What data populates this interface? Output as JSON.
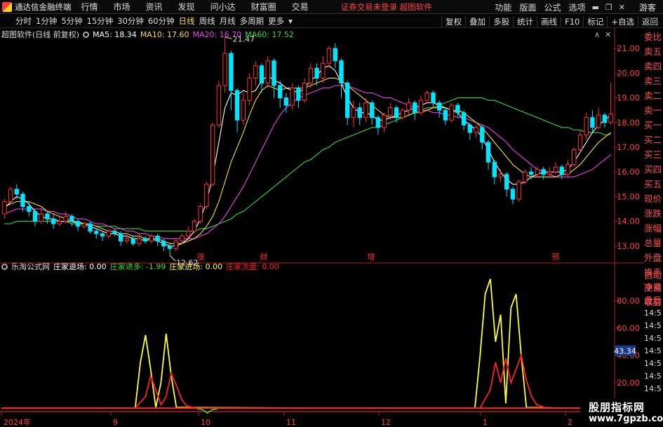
{
  "app": {
    "name": "通达信金融终端"
  },
  "menu": [
    "行情",
    "市场",
    "资讯",
    "发现",
    "问小达",
    "财富圈",
    "交易"
  ],
  "center_notice": "证券交易未登录  超图软件",
  "right_menu": [
    "功能",
    "版面",
    "公式",
    "选项"
  ],
  "guest": "游客",
  "periods": [
    "分时",
    "1分钟",
    "5分钟",
    "15分钟",
    "30分钟",
    "60分钟",
    "日线",
    "周线",
    "月线",
    "多周期",
    "更多"
  ],
  "active_period": "日线",
  "toolbar_right": [
    "复权",
    "叠加",
    "多股",
    "统计",
    "画线",
    "F10",
    "标记",
    "+自选",
    "返回"
  ],
  "main_info": {
    "title": "超图软件(日线 前复权)",
    "ma5": "MA5: 18.34",
    "ma10": "MA10: 17.60",
    "ma20": "MA20: 16.70",
    "ma60": "MA60: 17.52"
  },
  "sub_info": {
    "title": "乐淘公式网",
    "l1": "庄家退场: 0.00",
    "l2": "庄家诱多: -1.99",
    "l3": "庄家进场: 0.00",
    "l4": "庄家洗盘: 0.00"
  },
  "colors": {
    "up": "#ff3232",
    "down": "#00e5ff",
    "ma5": "#ffffff",
    "ma10": "#ffdd33",
    "ma20": "#ee44ee",
    "ma60": "#33dd33",
    "axis": "#b02020",
    "yellow": "#ffff33",
    "red": "#ff2020"
  },
  "side_panel": {
    "main": [
      {
        "t": "委比",
        "c": "r"
      },
      {
        "t": "卖五",
        "c": "r"
      },
      {
        "t": "卖四",
        "c": "r"
      },
      {
        "t": "卖三",
        "c": "r"
      },
      {
        "t": "卖二",
        "c": "r"
      },
      {
        "t": "卖一",
        "c": "r"
      },
      {
        "t": "买一",
        "c": "r"
      },
      {
        "t": "买二",
        "c": "r"
      },
      {
        "t": "买三",
        "c": "r"
      },
      {
        "t": "买四",
        "c": "r"
      },
      {
        "t": "买五",
        "c": "r"
      },
      {
        "t": "现价",
        "c": "r"
      },
      {
        "t": "涨跌",
        "c": "r"
      },
      {
        "t": "涨幅",
        "c": "r"
      },
      {
        "t": "总量",
        "c": "r"
      },
      {
        "t": "外盘",
        "c": "r"
      },
      {
        "t": "换手",
        "c": "r"
      },
      {
        "t": "净资",
        "c": "r"
      },
      {
        "t": "收益",
        "c": "r"
      }
    ],
    "sub": [
      {
        "t": "自动",
        "c": "r"
      },
      {
        "t": "交易",
        "c": "r"
      },
      {
        "t": "盘后",
        "c": "r"
      },
      {
        "t": "14:5",
        "c": "time"
      },
      {
        "t": "14:5",
        "c": "time"
      },
      {
        "t": "14:5",
        "c": "time"
      },
      {
        "t": "14:5",
        "c": "time"
      },
      {
        "t": "14:5",
        "c": "time"
      },
      {
        "t": "14:5",
        "c": "time"
      },
      {
        "t": "14:5",
        "c": "time"
      },
      {
        "t": "14:5",
        "c": "time"
      },
      {
        "t": "14:5",
        "c": "time"
      }
    ]
  },
  "watermark": {
    "line1": "股朋指标网",
    "line2": "www.7gpzb.com"
  },
  "chart_data": {
    "type": "candlestick",
    "price_ticks": [
      "21.00",
      "20.00",
      "19.00",
      "18.00",
      "17.00",
      "16.00",
      "15.00",
      "14.00",
      "13.00"
    ],
    "price_range": [
      12.4,
      21.6
    ],
    "high_label": "21.47",
    "low_label": "12.62",
    "event_markers": [
      "涨",
      "财",
      "增",
      "预"
    ],
    "sub_ticks": [
      "80.00",
      "60.00",
      "40.00",
      "20.00"
    ],
    "sub_range": [
      0,
      100
    ],
    "sub_current": "43.34",
    "x_labels": [
      "2024年",
      "9",
      "10",
      "11",
      "12",
      "1",
      "2"
    ],
    "candles": [
      [
        14.3,
        14.8,
        14.1,
        14.9
      ],
      [
        14.8,
        15.3,
        14.7,
        15.4
      ],
      [
        15.3,
        15.1,
        14.9,
        15.5
      ],
      [
        15.1,
        14.6,
        14.4,
        15.2
      ],
      [
        14.6,
        14.4,
        14.2,
        14.8
      ],
      [
        14.4,
        14.0,
        13.8,
        14.5
      ],
      [
        14.0,
        14.3,
        13.9,
        14.5
      ],
      [
        14.3,
        14.1,
        13.9,
        14.4
      ],
      [
        14.1,
        13.9,
        13.7,
        14.3
      ],
      [
        13.9,
        14.0,
        13.8,
        14.2
      ],
      [
        14.0,
        14.2,
        13.9,
        14.4
      ],
      [
        14.2,
        14.0,
        13.8,
        14.3
      ],
      [
        14.0,
        13.8,
        13.6,
        14.1
      ],
      [
        13.8,
        13.9,
        13.7,
        14.0
      ],
      [
        13.9,
        13.6,
        13.5,
        14.0
      ],
      [
        13.6,
        13.5,
        13.3,
        13.7
      ],
      [
        13.5,
        13.4,
        13.2,
        13.6
      ],
      [
        13.4,
        13.6,
        13.3,
        13.7
      ],
      [
        13.6,
        13.5,
        13.4,
        13.7
      ],
      [
        13.5,
        13.2,
        13.0,
        13.6
      ],
      [
        13.2,
        13.3,
        13.1,
        13.5
      ],
      [
        13.3,
        13.1,
        13.0,
        13.4
      ],
      [
        13.1,
        13.3,
        13.0,
        13.5
      ],
      [
        13.3,
        13.2,
        13.1,
        13.4
      ],
      [
        13.2,
        13.4,
        13.1,
        13.5
      ],
      [
        13.4,
        13.2,
        13.0,
        13.5
      ],
      [
        13.2,
        13.0,
        12.8,
        13.3
      ],
      [
        13.0,
        12.9,
        12.62,
        13.1
      ],
      [
        12.9,
        13.2,
        12.8,
        13.3
      ],
      [
        13.2,
        13.4,
        13.1,
        13.5
      ],
      [
        13.4,
        13.6,
        13.3,
        13.8
      ],
      [
        13.6,
        14.0,
        13.5,
        14.1
      ],
      [
        14.0,
        14.6,
        13.9,
        14.7
      ],
      [
        14.6,
        15.5,
        14.5,
        15.6
      ],
      [
        15.5,
        17.9,
        15.4,
        18.0
      ],
      [
        17.9,
        19.5,
        17.8,
        19.7
      ],
      [
        19.5,
        20.8,
        19.2,
        21.47
      ],
      [
        20.8,
        19.3,
        18.5,
        20.9
      ],
      [
        19.3,
        18.1,
        17.6,
        19.4
      ],
      [
        18.1,
        18.9,
        17.9,
        19.2
      ],
      [
        18.9,
        19.8,
        18.7,
        20.0
      ],
      [
        19.8,
        20.3,
        19.5,
        20.5
      ],
      [
        20.3,
        19.6,
        19.2,
        20.4
      ],
      [
        19.6,
        20.5,
        19.4,
        20.7
      ],
      [
        20.5,
        19.5,
        19.0,
        20.6
      ],
      [
        19.5,
        19.0,
        18.6,
        19.7
      ],
      [
        19.0,
        18.7,
        18.4,
        19.2
      ],
      [
        18.7,
        19.4,
        18.5,
        19.6
      ],
      [
        19.4,
        18.9,
        18.6,
        19.5
      ],
      [
        18.9,
        19.6,
        18.8,
        19.8
      ],
      [
        19.6,
        20.2,
        19.4,
        20.4
      ],
      [
        20.2,
        19.8,
        19.5,
        20.4
      ],
      [
        19.8,
        20.4,
        19.6,
        20.7
      ],
      [
        20.4,
        21.0,
        20.2,
        21.1
      ],
      [
        21.0,
        20.5,
        20.2,
        21.2
      ],
      [
        20.5,
        19.6,
        19.0,
        20.6
      ],
      [
        19.6,
        18.2,
        17.9,
        19.7
      ],
      [
        18.2,
        18.6,
        17.8,
        18.9
      ],
      [
        18.6,
        18.2,
        17.9,
        18.8
      ],
      [
        18.2,
        18.8,
        18.0,
        19.0
      ],
      [
        18.8,
        18.2,
        17.9,
        18.9
      ],
      [
        18.2,
        17.8,
        17.5,
        18.3
      ],
      [
        17.8,
        18.3,
        17.6,
        18.4
      ],
      [
        18.3,
        18.6,
        18.1,
        18.8
      ],
      [
        18.6,
        18.2,
        18.0,
        18.7
      ],
      [
        18.2,
        18.5,
        18.1,
        18.6
      ],
      [
        18.5,
        18.8,
        18.3,
        19.0
      ],
      [
        18.8,
        18.4,
        18.1,
        18.9
      ],
      [
        18.4,
        18.9,
        18.3,
        19.1
      ],
      [
        18.9,
        19.2,
        18.8,
        19.3
      ],
      [
        19.2,
        18.8,
        18.6,
        19.3
      ],
      [
        18.8,
        18.5,
        18.2,
        18.9
      ],
      [
        18.5,
        18.1,
        17.9,
        18.6
      ],
      [
        18.1,
        18.7,
        18.0,
        18.8
      ],
      [
        18.7,
        18.4,
        18.2,
        18.8
      ],
      [
        18.4,
        17.9,
        17.7,
        18.5
      ],
      [
        17.9,
        17.6,
        17.3,
        18.0
      ],
      [
        17.6,
        17.8,
        17.4,
        17.9
      ],
      [
        17.8,
        17.2,
        16.9,
        17.9
      ],
      [
        17.2,
        16.4,
        16.1,
        17.3
      ],
      [
        16.4,
        15.8,
        15.5,
        16.5
      ],
      [
        15.8,
        15.9,
        15.6,
        16.1
      ],
      [
        15.9,
        15.3,
        15.0,
        16.0
      ],
      [
        15.3,
        14.9,
        14.7,
        15.4
      ],
      [
        14.9,
        15.6,
        14.8,
        15.7
      ],
      [
        15.6,
        16.0,
        15.5,
        16.1
      ],
      [
        16.0,
        15.9,
        15.7,
        16.2
      ],
      [
        15.9,
        16.1,
        15.8,
        16.2
      ],
      [
        16.1,
        15.9,
        15.7,
        16.2
      ],
      [
        15.9,
        16.0,
        15.8,
        16.2
      ],
      [
        16.0,
        16.2,
        15.9,
        16.4
      ],
      [
        16.2,
        15.9,
        15.7,
        16.3
      ],
      [
        15.9,
        16.3,
        15.8,
        16.5
      ],
      [
        16.3,
        16.9,
        16.2,
        17.0
      ],
      [
        16.9,
        17.5,
        16.8,
        17.7
      ],
      [
        17.5,
        18.2,
        17.3,
        18.4
      ],
      [
        18.2,
        17.8,
        17.6,
        18.5
      ],
      [
        17.8,
        18.3,
        17.7,
        18.6
      ],
      [
        18.3,
        18.0,
        17.8,
        18.4
      ],
      [
        18.0,
        18.34,
        17.9,
        19.6
      ]
    ],
    "ma5": [
      14.5,
      14.8,
      15.0,
      14.9,
      14.7,
      14.4,
      14.2,
      14.1,
      14.1,
      14.0,
      14.0,
      14.0,
      13.9,
      13.9,
      13.8,
      13.7,
      13.6,
      13.5,
      13.5,
      13.4,
      13.4,
      13.3,
      13.3,
      13.2,
      13.3,
      13.2,
      13.1,
      13.0,
      13.0,
      13.1,
      13.3,
      13.6,
      14.1,
      14.8,
      15.8,
      17.2,
      18.6,
      19.2,
      19.1,
      19.3,
      19.2,
      19.3,
      19.7,
      19.9,
      19.7,
      19.6,
      19.4,
      19.3,
      19.2,
      19.4,
      19.7,
      19.9,
      20.2,
      20.3,
      20.1,
      19.6,
      19.0,
      18.6,
      18.4,
      18.4,
      18.3,
      18.1,
      18.1,
      18.2,
      18.3,
      18.4,
      18.5,
      18.6,
      18.7,
      18.8,
      18.8,
      18.7,
      18.6,
      18.5,
      18.4,
      18.1,
      17.9,
      17.7,
      17.4,
      16.9,
      16.4,
      16.0,
      15.7,
      15.5,
      15.5,
      15.6,
      15.8,
      15.9,
      16.0,
      16.0,
      16.0,
      16.0,
      16.1,
      16.4,
      16.8,
      17.2,
      17.6,
      17.9,
      18.1,
      18.3
    ],
    "ma10": [
      14.6,
      14.7,
      14.8,
      14.8,
      14.8,
      14.7,
      14.6,
      14.4,
      14.3,
      14.2,
      14.1,
      14.0,
      14.0,
      13.9,
      13.9,
      13.8,
      13.7,
      13.6,
      13.6,
      13.5,
      13.5,
      13.4,
      13.4,
      13.3,
      13.3,
      13.3,
      13.2,
      13.1,
      13.1,
      13.1,
      13.2,
      13.3,
      13.5,
      13.8,
      14.2,
      14.8,
      15.6,
      16.4,
      17.0,
      17.6,
      18.3,
      18.9,
      19.3,
      19.5,
      19.4,
      19.3,
      19.4,
      19.4,
      19.4,
      19.4,
      19.5,
      19.6,
      19.7,
      19.8,
      19.8,
      19.7,
      19.5,
      19.3,
      19.1,
      18.9,
      18.7,
      18.5,
      18.3,
      18.2,
      18.2,
      18.2,
      18.3,
      18.4,
      18.4,
      18.5,
      18.6,
      18.6,
      18.6,
      18.5,
      18.5,
      18.4,
      18.2,
      18.0,
      17.8,
      17.5,
      17.2,
      16.9,
      16.6,
      16.3,
      16.1,
      15.9,
      15.8,
      15.8,
      15.8,
      15.8,
      15.8,
      15.9,
      15.9,
      16.1,
      16.3,
      16.6,
      16.9,
      17.2,
      17.4,
      17.6
    ],
    "ma20": [
      14.3,
      14.4,
      14.5,
      14.5,
      14.5,
      14.5,
      14.5,
      14.4,
      14.4,
      14.3,
      14.3,
      14.2,
      14.1,
      14.1,
      14.0,
      13.9,
      13.9,
      13.8,
      13.7,
      13.7,
      13.6,
      13.6,
      13.5,
      13.5,
      13.4,
      13.4,
      13.3,
      13.3,
      13.3,
      13.3,
      13.3,
      13.3,
      13.4,
      13.5,
      13.7,
      13.9,
      14.2,
      14.6,
      15.0,
      15.4,
      15.9,
      16.4,
      16.9,
      17.4,
      17.9,
      18.3,
      18.6,
      18.8,
      19.0,
      19.1,
      19.2,
      19.3,
      19.4,
      19.4,
      19.5,
      19.5,
      19.5,
      19.4,
      19.3,
      19.2,
      19.2,
      19.1,
      19.0,
      19.0,
      18.9,
      18.8,
      18.7,
      18.6,
      18.5,
      18.5,
      18.4,
      18.4,
      18.3,
      18.3,
      18.2,
      18.2,
      18.1,
      18.0,
      17.9,
      17.8,
      17.6,
      17.4,
      17.2,
      16.9,
      16.7,
      16.5,
      16.3,
      16.1,
      16.0,
      15.9,
      15.8,
      15.8,
      15.8,
      15.8,
      15.9,
      16.0,
      16.1,
      16.3,
      16.5,
      16.7
    ],
    "ma60": [
      13.9,
      13.9,
      14.0,
      14.0,
      14.0,
      14.0,
      14.0,
      14.0,
      14.0,
      14.0,
      14.0,
      13.9,
      13.9,
      13.9,
      13.9,
      13.8,
      13.8,
      13.8,
      13.8,
      13.7,
      13.7,
      13.7,
      13.7,
      13.6,
      13.6,
      13.6,
      13.6,
      13.6,
      13.6,
      13.6,
      13.6,
      13.6,
      13.7,
      13.7,
      13.8,
      13.9,
      14.0,
      14.1,
      14.3,
      14.4,
      14.6,
      14.8,
      15.0,
      15.2,
      15.4,
      15.6,
      15.8,
      16.0,
      16.2,
      16.4,
      16.5,
      16.7,
      16.9,
      17.0,
      17.2,
      17.3,
      17.4,
      17.5,
      17.6,
      17.7,
      17.8,
      17.8,
      17.9,
      18.0,
      18.1,
      18.2,
      18.3,
      18.4,
      18.5,
      18.6,
      18.6,
      18.7,
      18.8,
      18.9,
      19.0,
      19.0,
      19.0,
      19.0,
      19.0,
      18.9,
      18.9,
      18.8,
      18.7,
      18.6,
      18.5,
      18.4,
      18.3,
      18.2,
      18.1,
      18.0,
      17.9,
      17.8,
      17.8,
      17.7,
      17.7,
      17.6,
      17.6,
      17.6,
      17.5,
      17.52
    ],
    "sub_yellow": [
      [
        0,
        1.5
      ],
      [
        26,
        1.5
      ],
      [
        27,
        35
      ],
      [
        28,
        55
      ],
      [
        29,
        30
      ],
      [
        30,
        2
      ],
      [
        31,
        20
      ],
      [
        32,
        56
      ],
      [
        33,
        25
      ],
      [
        34,
        2
      ],
      [
        60,
        1.5
      ],
      [
        92,
        1.5
      ],
      [
        93,
        40
      ],
      [
        94,
        85
      ],
      [
        95,
        96
      ],
      [
        96,
        50
      ],
      [
        97,
        70
      ],
      [
        98,
        5
      ],
      [
        99,
        75
      ],
      [
        100,
        85
      ],
      [
        101,
        40
      ],
      [
        102,
        2
      ],
      [
        110,
        1.5
      ],
      [
        119,
        1.5
      ]
    ],
    "sub_red": [
      [
        0,
        1.5
      ],
      [
        26,
        1.5
      ],
      [
        28,
        10
      ],
      [
        29,
        25
      ],
      [
        30,
        15
      ],
      [
        31,
        4
      ],
      [
        32,
        10
      ],
      [
        33,
        27
      ],
      [
        34,
        18
      ],
      [
        35,
        8
      ],
      [
        36,
        3
      ],
      [
        38,
        1.5
      ],
      [
        93,
        1.5
      ],
      [
        95,
        15
      ],
      [
        96,
        35
      ],
      [
        97,
        20
      ],
      [
        98,
        38
      ],
      [
        99,
        20
      ],
      [
        100,
        30
      ],
      [
        101,
        40
      ],
      [
        102,
        22
      ],
      [
        103,
        10
      ],
      [
        104,
        4
      ],
      [
        106,
        1.5
      ],
      [
        119,
        1.5
      ]
    ],
    "sub_green_segment": [
      [
        38,
        1.0
      ],
      [
        39,
        0.5
      ],
      [
        40,
        -1.99
      ],
      [
        41,
        0.3
      ],
      [
        42,
        1.0
      ]
    ]
  }
}
